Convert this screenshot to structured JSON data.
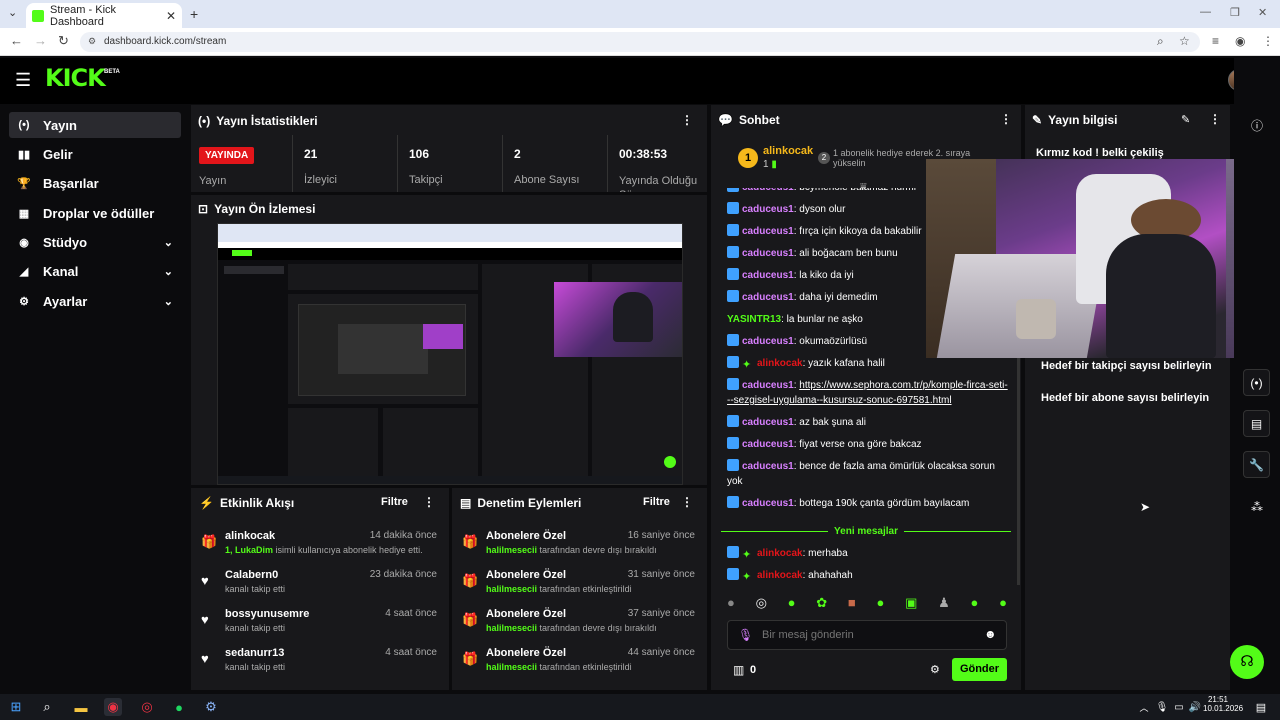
{
  "browser": {
    "tab_title": "Stream - Kick Dashboard",
    "url": "dashboard.kick.com/stream"
  },
  "brand": {
    "logo": "KICK",
    "beta": "BETA",
    "accent": "#53fc18"
  },
  "sidebar": {
    "items": [
      {
        "label": "Yayın",
        "icon": "broadcast-icon"
      },
      {
        "label": "Gelir",
        "icon": "revenue-icon"
      },
      {
        "label": "Başarılar",
        "icon": "trophy-icon"
      },
      {
        "label": "Droplar ve ödüller",
        "icon": "drops-icon"
      },
      {
        "label": "Stüdyo",
        "icon": "studio-icon"
      },
      {
        "label": "Kanal",
        "icon": "channel-icon"
      },
      {
        "label": "Ayarlar",
        "icon": "gear-icon"
      }
    ]
  },
  "stats": {
    "title": "Yayın İstatistikleri",
    "live_badge": "YAYINDA",
    "live_label": "Yayın",
    "items": [
      {
        "value": "21",
        "label": "İzleyici"
      },
      {
        "value": "106",
        "label": "Takipçi"
      },
      {
        "value": "2",
        "label": "Abone Sayısı"
      },
      {
        "value": "00:38:53",
        "label": "Yayında Olduğu Süre"
      }
    ]
  },
  "preview": {
    "title": "Yayın Ön İzlemesi"
  },
  "activity": {
    "title": "Etkinlik Akışı",
    "filter": "Filtre",
    "items": [
      {
        "name": "alinkocak",
        "time": "14 dakika önce",
        "desc_hl": "1, LukaDim",
        "desc": " isimli kullanıcıya abonelik hediye etti.",
        "icon": "gift-icon"
      },
      {
        "name": "Calabern0",
        "time": "23 dakika önce",
        "desc": "kanalı takip etti",
        "icon": "heart-icon"
      },
      {
        "name": "bossyunusemre",
        "time": "4 saat önce",
        "desc": "kanalı takip etti",
        "icon": "heart-icon"
      },
      {
        "name": "sedanurr13",
        "time": "4 saat önce",
        "desc": "kanalı takip etti",
        "icon": "heart-icon"
      }
    ]
  },
  "moderation": {
    "title": "Denetim Eylemleri",
    "filter": "Filtre",
    "items": [
      {
        "name": "Abonelere Özel",
        "time": "16 saniye önce",
        "by": "halilmesecii",
        "desc": " tarafından devre dışı bırakıldı"
      },
      {
        "name": "Abonelere Özel",
        "time": "31 saniye önce",
        "by": "halilmesecii",
        "desc": " tarafından etkinleştirildi"
      },
      {
        "name": "Abonelere Özel",
        "time": "37 saniye önce",
        "by": "halilmesecii",
        "desc": " tarafından devre dışı bırakıldı"
      },
      {
        "name": "Abonelere Özel",
        "time": "44 saniye önce",
        "by": "halilmesecii",
        "desc": " tarafından etkinleştirildi"
      }
    ]
  },
  "chat": {
    "title": "Sohbet",
    "pinned_user": "alinkocak",
    "pinned_rank": "1",
    "pinned_count": "1",
    "pinned_text": "1 abonelik hediye ederek 2. sıraya yükselin",
    "messages": [
      {
        "user": "caduceus1",
        "text": "bcymenole bulamaz nurmr",
        "type": "sub"
      },
      {
        "user": "caduceus1",
        "text": "dyson olur",
        "type": "sub"
      },
      {
        "user": "caduceus1",
        "text": "fırça için kikoya da bakabilir",
        "type": "sub"
      },
      {
        "user": "caduceus1",
        "text": "ali boğacam ben bunu",
        "type": "sub"
      },
      {
        "user": "caduceus1",
        "text": "la kiko da iyi",
        "type": "sub"
      },
      {
        "user": "caduceus1",
        "text": "daha iyi demedim",
        "type": "sub"
      },
      {
        "user": "YASINTR13",
        "text": "la bunlar ne aşko",
        "type": "plain"
      },
      {
        "user": "caduceus1",
        "text": "okumaözürlüsü",
        "type": "sub"
      },
      {
        "user": "alinkocak",
        "text": "yazık kafana halil",
        "type": "vip"
      },
      {
        "user": "caduceus1",
        "text": "https://www.sephora.com.tr/p/komple-firca-seti---sezgisel-uygulama--kusursuz-sonuc-697581.html",
        "type": "sub",
        "link": true
      },
      {
        "user": "caduceus1",
        "text": "az bak şuna ali",
        "type": "sub"
      },
      {
        "user": "caduceus1",
        "text": "fiyat verse ona göre bakcaz",
        "type": "sub"
      },
      {
        "user": "caduceus1",
        "text": "bence de fazla ama ömürlük olacaksa sorun yok",
        "type": "sub"
      },
      {
        "user": "caduceus1",
        "text": "bottega 190k çanta gördüm bayılacam",
        "type": "sub"
      }
    ],
    "new_messages": "Yeni mesajlar",
    "new": [
      {
        "user": "alinkocak",
        "text": "merhaba"
      },
      {
        "user": "alinkocak",
        "text": "ahahahah"
      }
    ],
    "input_placeholder": "Bir mesaj gönderin",
    "points": "0",
    "send": "Gönder"
  },
  "info": {
    "title": "Yayın bilgisi",
    "stream_title": "Kırmız kod ! belki çekiliş",
    "goal_follow": "Hedef bir takipçi sayısı belirleyin",
    "goal_sub": "Hedef bir abone sayısı belirleyin"
  },
  "taskbar": {
    "time": "21:51",
    "date": "10.01.2026"
  }
}
